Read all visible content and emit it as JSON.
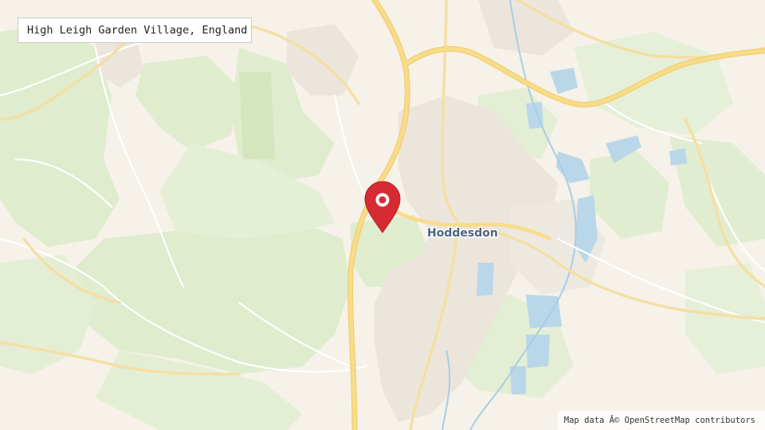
{
  "location": {
    "title": "High Leigh Garden Village, England"
  },
  "map": {
    "town_label": "Hoddesdon",
    "marker_icon": "map-pin-icon",
    "marker_color": "#d62b32",
    "attribution": "Map data Â© OpenStreetMap contributors",
    "colors": {
      "land": "#f6f2e9",
      "wood": "#dfeccd",
      "urban": "#ebe5dd",
      "water": "#b8d6e8",
      "major_road": "#f6d88a",
      "minor_road": "#ffffff"
    }
  }
}
